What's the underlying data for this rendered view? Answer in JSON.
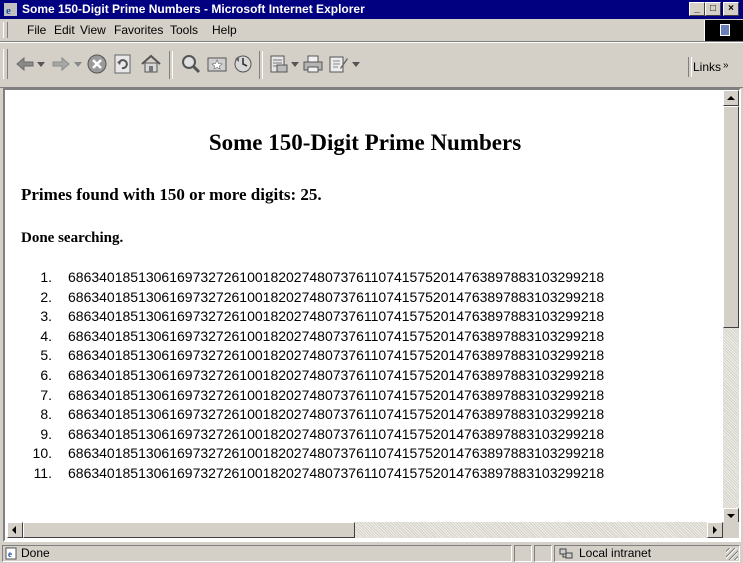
{
  "window": {
    "title": "Some 150-Digit Prime Numbers - Microsoft Internet Explorer",
    "buttons": {
      "minimize": "_",
      "maximize": "□",
      "close": "×"
    }
  },
  "menu": [
    "File",
    "Edit",
    "View",
    "Favorites",
    "Tools",
    "Help"
  ],
  "toolbar": {
    "icons": [
      "back-icon",
      "forward-icon",
      "stop-icon",
      "refresh-icon",
      "home-icon",
      "search-icon",
      "favorites-icon",
      "history-icon",
      "mail-icon",
      "print-icon",
      "edit-icon"
    ],
    "links_label": "Links",
    "links_chevron": "»"
  },
  "page": {
    "heading": "Some 150-Digit Prime Numbers",
    "summary": "Primes found with 150 or more digits: 25.",
    "status": "Done searching.",
    "primes": [
      {
        "n": "1.",
        "value": "686340185130616973272610018202748073761107415752014763897883103299218"
      },
      {
        "n": "2.",
        "value": "686340185130616973272610018202748073761107415752014763897883103299218"
      },
      {
        "n": "3.",
        "value": "686340185130616973272610018202748073761107415752014763897883103299218"
      },
      {
        "n": "4.",
        "value": "686340185130616973272610018202748073761107415752014763897883103299218"
      },
      {
        "n": "5.",
        "value": "686340185130616973272610018202748073761107415752014763897883103299218"
      },
      {
        "n": "6.",
        "value": "686340185130616973272610018202748073761107415752014763897883103299218"
      },
      {
        "n": "7.",
        "value": "686340185130616973272610018202748073761107415752014763897883103299218"
      },
      {
        "n": "8.",
        "value": "686340185130616973272610018202748073761107415752014763897883103299218"
      },
      {
        "n": "9.",
        "value": "686340185130616973272610018202748073761107415752014763897883103299218"
      },
      {
        "n": "10.",
        "value": "686340185130616973272610018202748073761107415752014763897883103299218"
      },
      {
        "n": "11.",
        "value": "686340185130616973272610018202748073761107415752014763897883103299218"
      }
    ]
  },
  "statusbar": {
    "left": "Done",
    "zone": "Local intranet"
  },
  "colors": {
    "titlebar": "#000080",
    "chrome": "#d4d0c8",
    "page_bg": "#ffffff"
  }
}
